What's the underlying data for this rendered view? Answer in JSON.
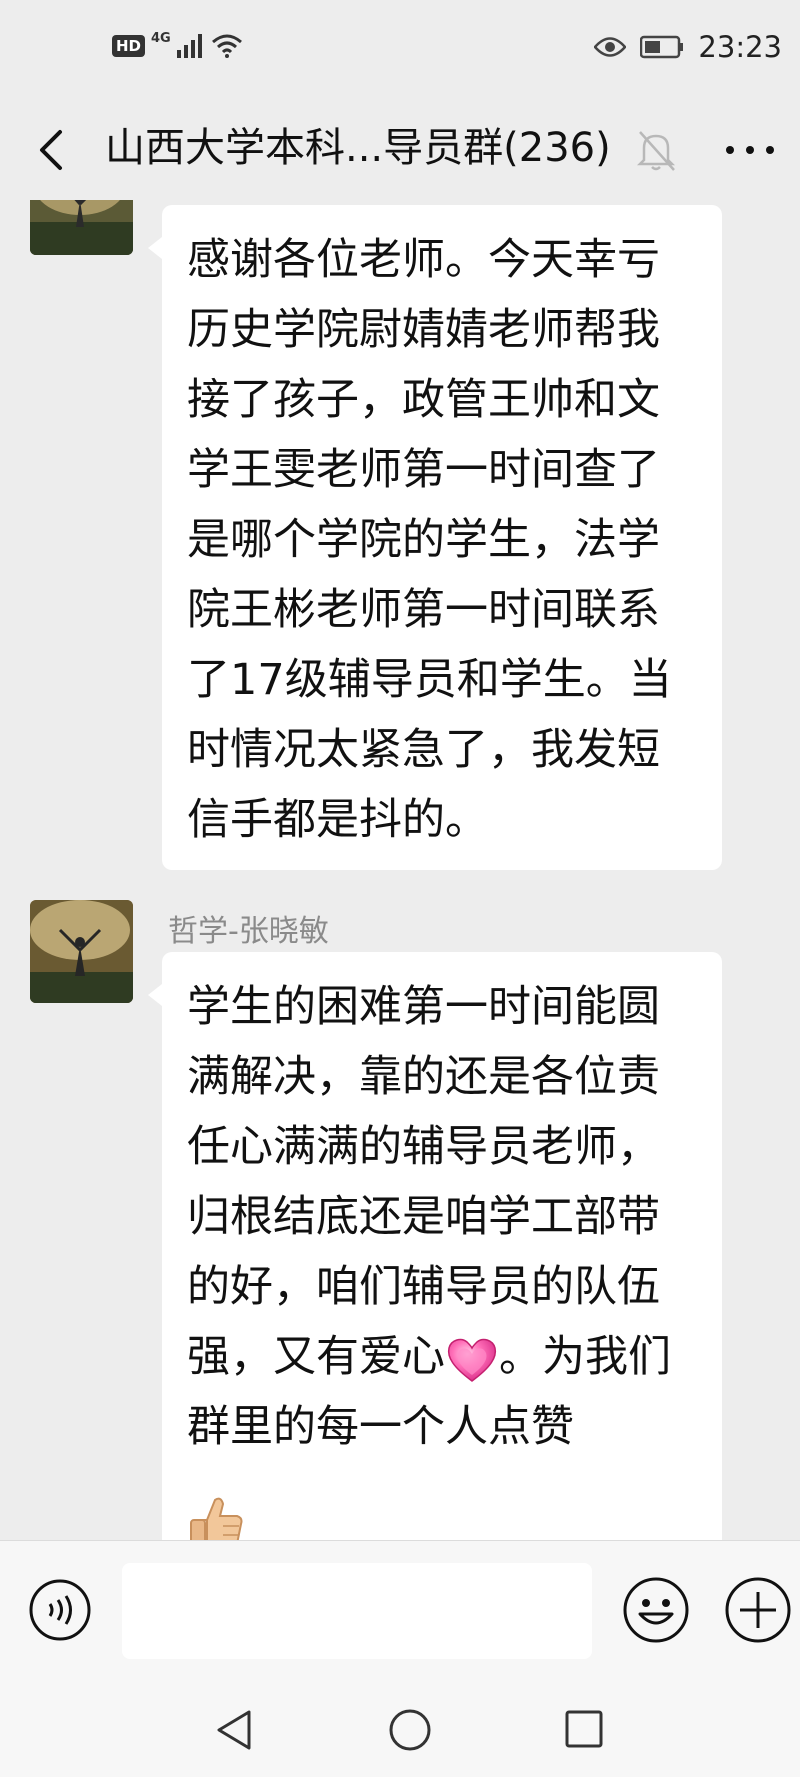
{
  "status_bar": {
    "hd": "HD",
    "network": "4G",
    "time": "23:23",
    "icons": [
      "signal-icon",
      "wifi-icon",
      "eye-icon",
      "battery-icon"
    ]
  },
  "header": {
    "title": "山西大学本科...导员群(236)",
    "icons": [
      "back-arrow-icon",
      "mute-bell-icon",
      "more-dots-icon"
    ]
  },
  "messages": [
    {
      "sender": "",
      "text": "感谢各位老师。今天幸亏历史学院尉婧婧老师帮我接了孩子，政管王帅和文学王雯老师第一时间查了是哪个学院的学生，法学院王彬老师第一时间联系了17级辅导员和学生。当时情况太紧急了，我发短信手都是抖的。"
    },
    {
      "sender": "哲学-张晓敏",
      "text_before_emoji": "学生的困难第一时间能圆满解决，靠的还是各位责任心满满的辅导员老师，归根结底还是咱学工部带的好，咱们辅导员的队伍强，又有爱心",
      "text_after_emoji": "。为我们群里的每一个人点赞",
      "emojis": [
        "heart-emoji-icon",
        "thumbs-up-emoji-icon"
      ]
    }
  ],
  "input_bar": {
    "placeholder": "",
    "icons": [
      "voice-icon",
      "emoji-face-icon",
      "plus-icon"
    ]
  },
  "nav_bar": {
    "icons": [
      "nav-back-icon",
      "nav-home-icon",
      "nav-recent-icon"
    ]
  },
  "colors": {
    "background": "#ededed",
    "bubble": "#ffffff",
    "sender": "#8a8a8a",
    "bar": "#f7f7f7"
  }
}
